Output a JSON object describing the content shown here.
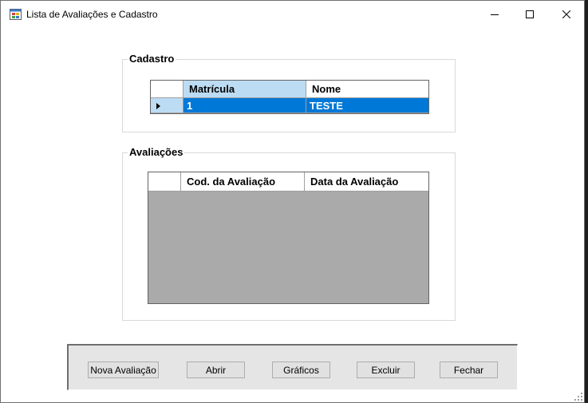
{
  "window": {
    "title": "Lista de Avaliações e Cadastro"
  },
  "cadastro": {
    "group_label": "Cadastro",
    "columns": [
      "Matrícula",
      "Nome"
    ],
    "rows": [
      {
        "matricula": "1",
        "nome": "TESTE",
        "selected": true
      }
    ]
  },
  "avaliacoes": {
    "group_label": "Avaliações",
    "columns": [
      "Cod. da Avaliação",
      "Data da Avaliação"
    ],
    "rows": []
  },
  "buttons": {
    "nova_avaliacao": "Nova Avaliação",
    "abrir": "Abrir",
    "graficos": "Gráficos",
    "excluir": "Excluir",
    "fechar": "Fechar"
  },
  "colors": {
    "selection": "#0078d7",
    "selected_header": "#bcdcf4",
    "grid_background": "#aaaaaa"
  }
}
